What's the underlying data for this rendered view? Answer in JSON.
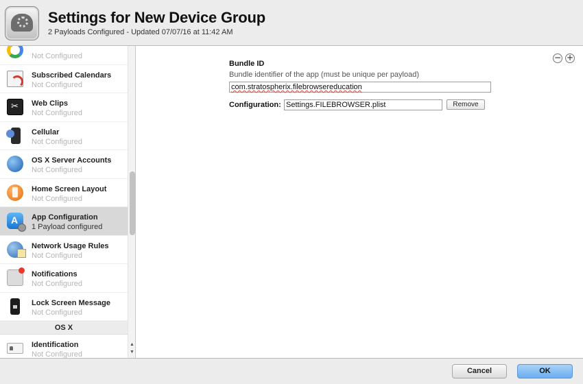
{
  "header": {
    "title": "Settings for New Device Group",
    "subtitle": "2 Payloads Configured - Updated 07/07/16 at 11:42 AM",
    "icon": "settings-cloud-icon"
  },
  "sidebar": {
    "items": [
      {
        "label": "",
        "status": "Not Configured",
        "icon": "google-icon"
      },
      {
        "label": "Subscribed Calendars",
        "status": "Not Configured",
        "icon": "calendar-subscription-icon"
      },
      {
        "label": "Web Clips",
        "status": "Not Configured",
        "icon": "web-clip-icon"
      },
      {
        "label": "Cellular",
        "status": "Not Configured",
        "icon": "cellular-icon"
      },
      {
        "label": "OS X Server Accounts",
        "status": "Not Configured",
        "icon": "globe-icon"
      },
      {
        "label": "Home Screen Layout",
        "status": "Not Configured",
        "icon": "home-screen-icon"
      },
      {
        "label": "App Configuration",
        "status": "1 Payload configured",
        "icon": "app-store-icon",
        "selected": true
      },
      {
        "label": "Network Usage Rules",
        "status": "Not Configured",
        "icon": "network-globe-icon"
      },
      {
        "label": "Notifications",
        "status": "Not Configured",
        "icon": "notifications-icon"
      },
      {
        "label": "Lock Screen Message",
        "status": "Not Configured",
        "icon": "lock-screen-icon"
      }
    ],
    "section_osx": "OS X",
    "osx_items": [
      {
        "label": "Identification",
        "status": "Not Configured",
        "icon": "id-card-icon"
      }
    ],
    "scroll_up": "▲",
    "scroll_down": "▼"
  },
  "main": {
    "minus": "−",
    "plus": "+",
    "bundle_id_label": "Bundle ID",
    "bundle_id_description": "Bundle identifier of the app (must be unique per payload)",
    "bundle_id_value": "com.stratospherix.filebrowsereducation",
    "configuration_label": "Configuration:",
    "configuration_value": "Settings.FILEBROWSER.plist",
    "remove_label": "Remove"
  },
  "footer": {
    "cancel_label": "Cancel",
    "ok_label": "OK"
  },
  "colors": {
    "selected_row": "#d8d8d8",
    "ok_button": "#69aef0",
    "spellcheck_underline": "#e0463b"
  }
}
